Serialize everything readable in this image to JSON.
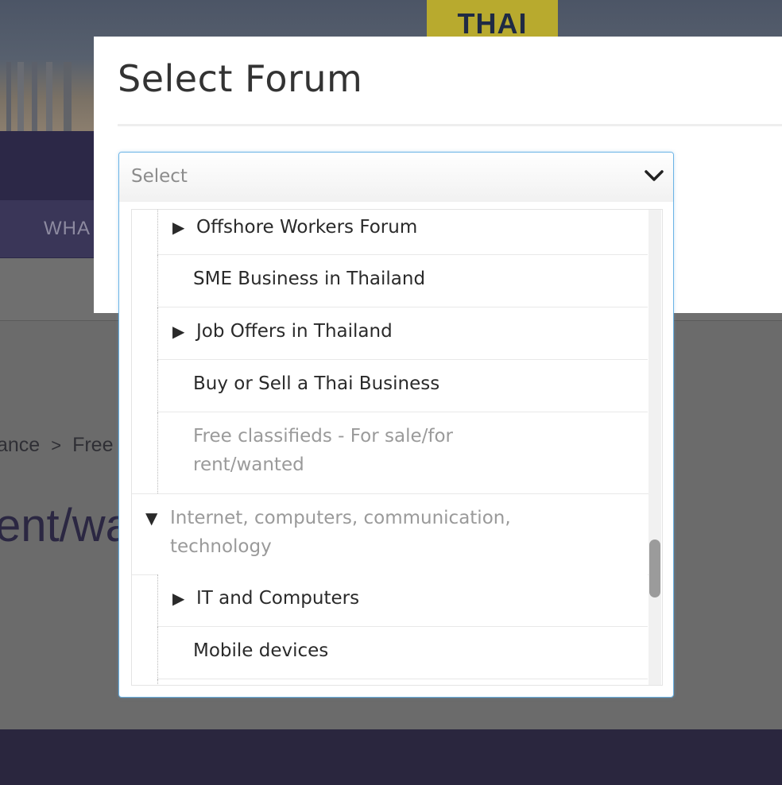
{
  "background": {
    "badge_text": "THAI",
    "nav_tab_label": "WHA",
    "breadcrumb": {
      "prev": "ance",
      "separator": ">",
      "current": "Free"
    },
    "page_title": "ent/wa"
  },
  "modal": {
    "title": "Select Forum",
    "select": {
      "placeholder": "Select",
      "options": [
        {
          "label": "Offshore Workers Forum",
          "level": 1,
          "expander": "collapsed",
          "disabled": false
        },
        {
          "label": "SME Business in Thailand",
          "level": 1,
          "expander": "none",
          "disabled": false
        },
        {
          "label": "Job Offers in Thailand",
          "level": 1,
          "expander": "collapsed",
          "disabled": false
        },
        {
          "label": "Buy or Sell a Thai Business",
          "level": 1,
          "expander": "none",
          "disabled": false
        },
        {
          "label_line1": "Free classifieds - For sale/for",
          "label_line2": "rent/wanted",
          "level": 1,
          "expander": "none",
          "disabled": true
        },
        {
          "label_line1": "Internet, computers, communication,",
          "label_line2": "technology",
          "level": 0,
          "expander": "expanded",
          "disabled": true
        },
        {
          "label": "IT and Computers",
          "level": 1,
          "expander": "collapsed",
          "disabled": false
        },
        {
          "label": "Mobile devices",
          "level": 1,
          "expander": "none",
          "disabled": false
        }
      ]
    }
  },
  "icons": {
    "collapsed": "▶",
    "expanded": "▼",
    "dropdown": "chevron-down-icon"
  },
  "colors": {
    "accent_border": "#6cb4e6",
    "disabled_text": "#9a9a9a",
    "nav_bg": "#2c2847"
  }
}
